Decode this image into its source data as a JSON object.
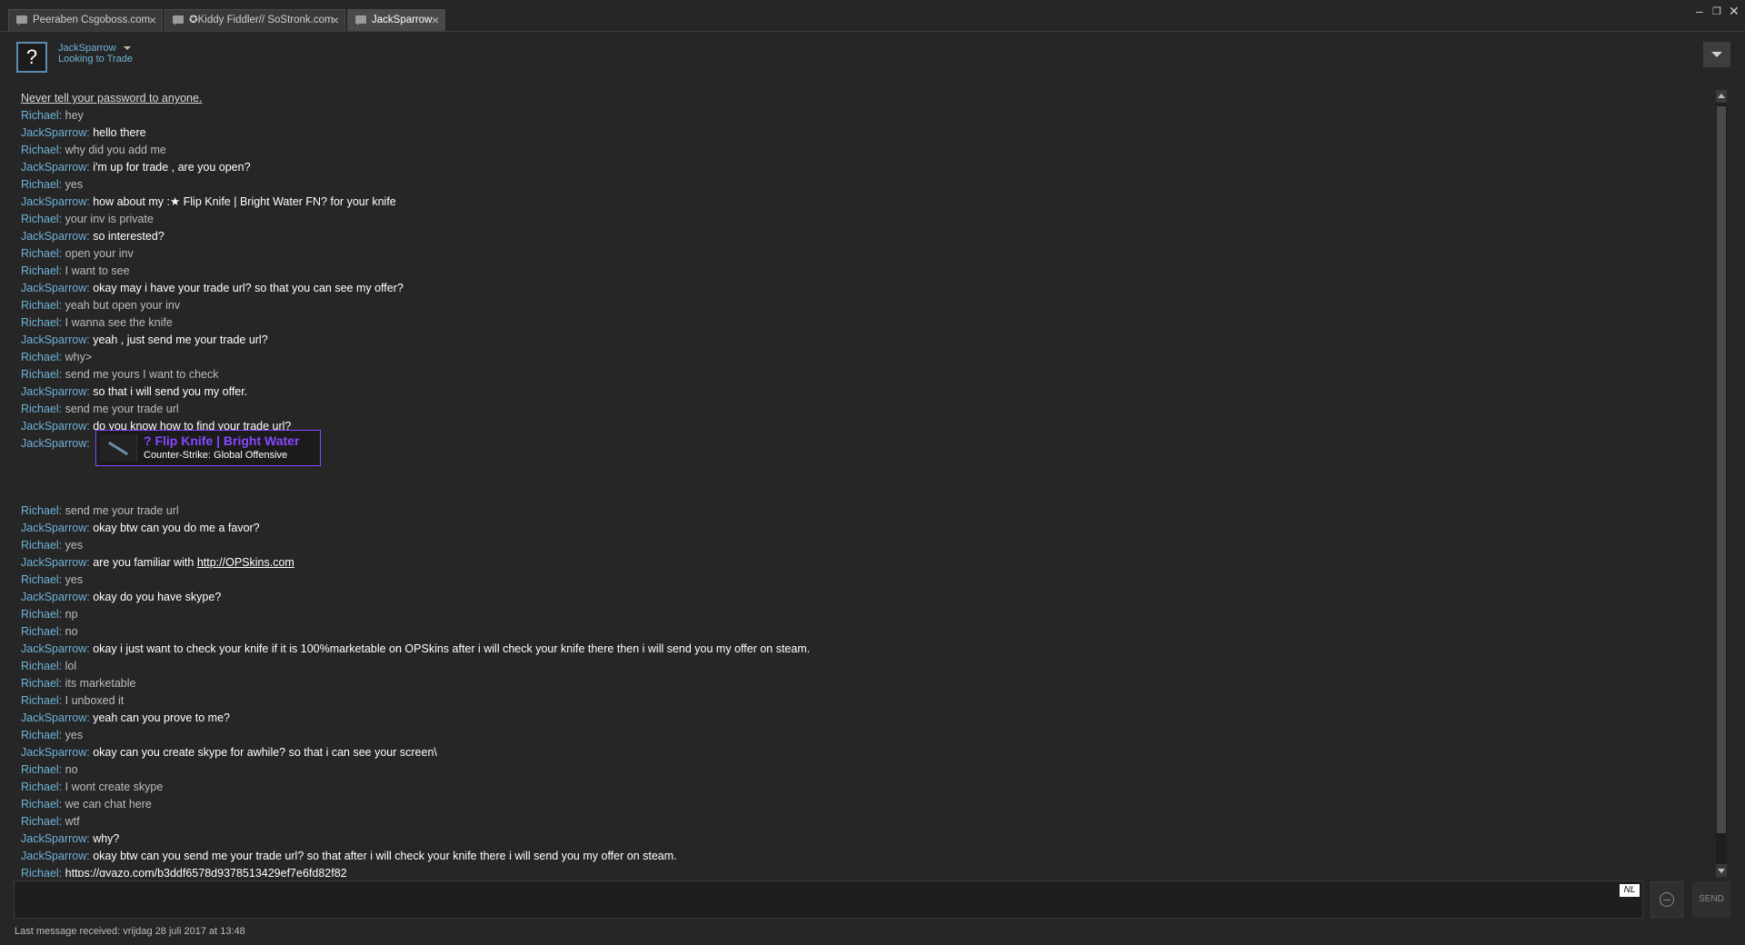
{
  "tabs": [
    {
      "label": "Peeraben Csgoboss.com"
    },
    {
      "label": "✪Kiddy Fiddler// SoStronk.com"
    },
    {
      "label": "JackSparrow"
    }
  ],
  "window_controls": {
    "minimize": "–",
    "restore": "❐",
    "close": "✕"
  },
  "contact": {
    "avatar": "?",
    "name": "JackSparrow",
    "status": "Looking to Trade"
  },
  "notice": "Never tell your password to anyone.",
  "messages_a": [
    {
      "sender": "Richael",
      "text": "hey"
    },
    {
      "sender": "JackSparrow",
      "text": "hello there"
    },
    {
      "sender": "Richael",
      "text": "why did you add me"
    },
    {
      "sender": "JackSparrow",
      "text": "i'm up for trade , are you open?"
    },
    {
      "sender": "Richael",
      "text": "yes"
    },
    {
      "sender": "JackSparrow",
      "text": "how about my :★ Flip Knife | Bright Water FN? for your knife"
    },
    {
      "sender": "Richael",
      "text": "your inv is private"
    },
    {
      "sender": "JackSparrow",
      "text": "so interested?"
    },
    {
      "sender": "Richael",
      "text": "open your inv"
    },
    {
      "sender": "Richael",
      "text": "I want to see"
    },
    {
      "sender": "JackSparrow",
      "text": "okay may i have your trade url? so that you can see my offer?"
    },
    {
      "sender": "Richael",
      "text": "yeah but open your inv"
    },
    {
      "sender": "Richael",
      "text": "I wanna see the knife"
    },
    {
      "sender": "JackSparrow",
      "text": "yeah , just send me your trade url?"
    },
    {
      "sender": "Richael",
      "text": "why>"
    },
    {
      "sender": "Richael",
      "text": "send me yours I want to check"
    },
    {
      "sender": "JackSparrow",
      "text": "so that i will send you my offer."
    },
    {
      "sender": "Richael",
      "text": "send me your trade url"
    },
    {
      "sender": "JackSparrow",
      "text": "do you know how to find your trade url?"
    }
  ],
  "item_message": {
    "sender": "JackSparrow",
    "item_name": "? Flip Knife | Bright Water",
    "item_game": "Counter-Strike: Global Offensive",
    "rarity_color": "#8847ff"
  },
  "messages_b": [
    {
      "sender": "Richael",
      "text": "send me your trade url"
    },
    {
      "sender": "JackSparrow",
      "text": "okay btw can you do me a favor?"
    },
    {
      "sender": "Richael",
      "text": "yes"
    },
    {
      "sender": "JackSparrow",
      "text": "are you familiar with ",
      "link": "http://OPSkins.com"
    },
    {
      "sender": "Richael",
      "text": "yes"
    },
    {
      "sender": "JackSparrow",
      "text": "okay do you have skype?"
    },
    {
      "sender": "Richael",
      "text": "np"
    },
    {
      "sender": "Richael",
      "text": "no"
    },
    {
      "sender": "JackSparrow",
      "text": "okay i just want to check your knife if it is 100%marketable on OPSkins after i will check your knife there then i will send you my offer on steam."
    },
    {
      "sender": "Richael",
      "text": "lol"
    },
    {
      "sender": "Richael",
      "text": "its marketable"
    },
    {
      "sender": "Richael",
      "text": "I unboxed it"
    },
    {
      "sender": "JackSparrow",
      "text": "yeah can you prove to me?"
    },
    {
      "sender": "Richael",
      "text": "yes"
    },
    {
      "sender": "JackSparrow",
      "text": "okay can you create skype for awhile? so that i can see your screen\\"
    },
    {
      "sender": "Richael",
      "text": "no"
    },
    {
      "sender": "Richael",
      "text": "I wont create skype"
    },
    {
      "sender": "Richael",
      "text": "we can chat here"
    },
    {
      "sender": "Richael",
      "text": "wtf"
    },
    {
      "sender": "JackSparrow",
      "text": "why?"
    },
    {
      "sender": "JackSparrow",
      "text": "okay btw can you send me your trade url? so that after i will check your knife there i will send you my offer on steam."
    },
    {
      "sender": "Richael",
      "text": "",
      "link": "https://gyazo.com/b3ddf6578d9378513429ef7e6fd82f82"
    }
  ],
  "input": {
    "language": "NL",
    "send_label": "SEND"
  },
  "footer": "Last message received: vrijdag 28 juli 2017 at 13:48",
  "colors": {
    "background": "#262626",
    "name": "#6fb3d9",
    "item_border": "#8847ff"
  }
}
